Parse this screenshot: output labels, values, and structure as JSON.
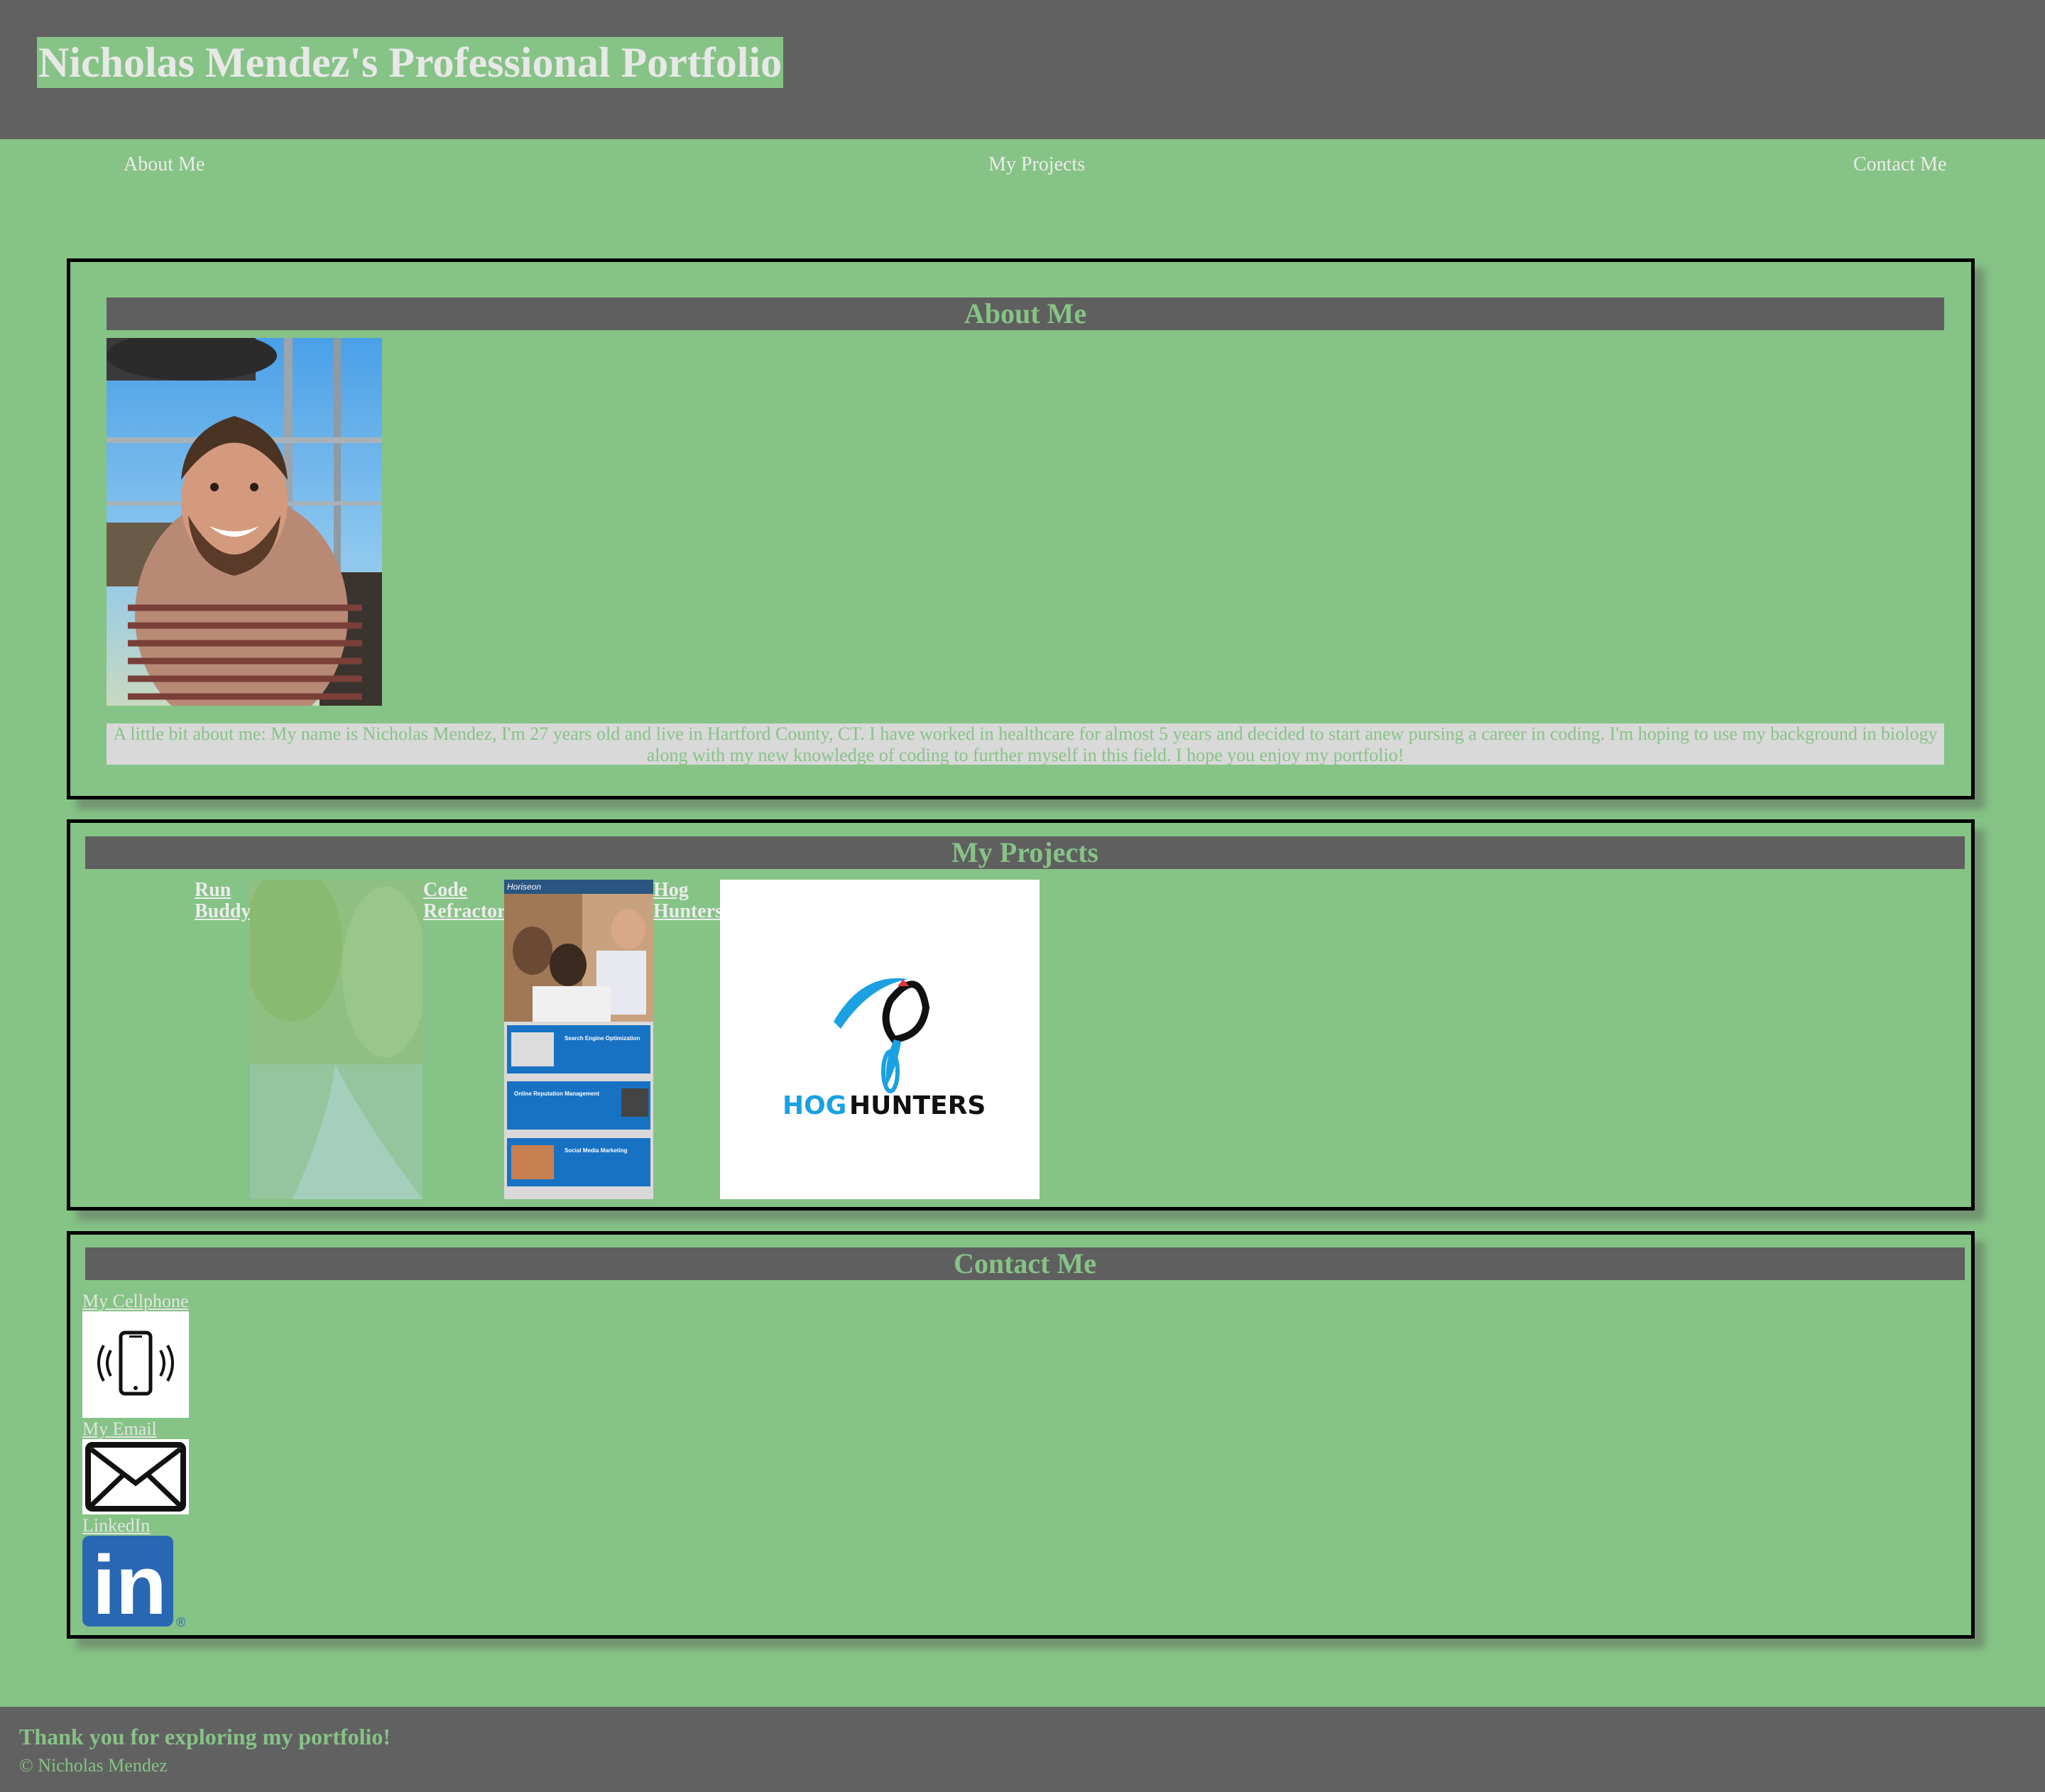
{
  "header": {
    "title": "Nicholas Mendez's Professional Portfolio"
  },
  "nav": {
    "items": [
      "About Me",
      "My Projects",
      "Contact Me"
    ]
  },
  "about": {
    "heading": "About Me",
    "bio": "A little bit about me: My name is Nicholas Mendez, I'm 27 years old and live in Hartford County, CT. I have worked in healthcare for almost 5 years and decided to start anew pursing a career in coding. I'm hoping to use my background in biology along with my new knowledge of coding to further myself in this field. I hope you enjoy my portfolio!"
  },
  "projects": {
    "heading": "My Projects",
    "items": [
      {
        "label": "Run Buddy"
      },
      {
        "label": "Code Refractor",
        "thumb_brand": "Horiseon",
        "thumb_nav": "Search Engine Optimization",
        "thumb_nav2": "Online Reputation Management",
        "thumb_nav3": "Social Media Marketing"
      },
      {
        "label": "Hog Hunters",
        "logo_word1": "HOG",
        "logo_word2": "HUNTERS"
      }
    ]
  },
  "contact": {
    "heading": "Contact Me",
    "links": [
      "My Cellphone",
      "My Email",
      "LinkedIn"
    ],
    "linkedin_logo": "in",
    "linkedin_mark": "®"
  },
  "footer": {
    "message": "Thank you for exploring my portfolio!",
    "copyright": "© Nicholas Mendez"
  },
  "colors": {
    "page_background": "#86c386",
    "header_background": "#616161",
    "heading_bar": "#5f5f5f",
    "bio_background": "#d9d9d9",
    "linkedin_blue": "#2867b2",
    "hog_blue": "#1ba1e2"
  }
}
